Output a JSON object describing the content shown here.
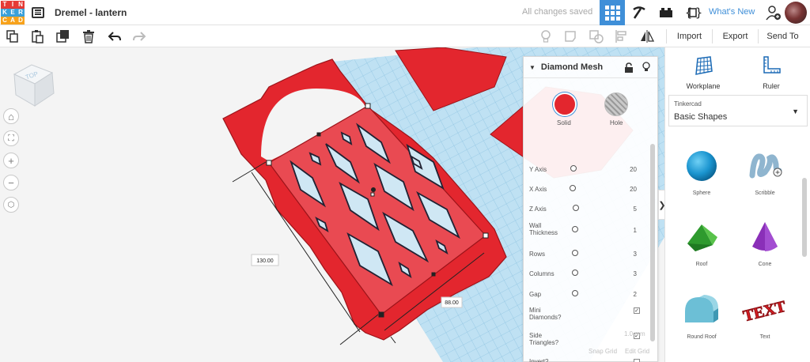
{
  "app": {
    "logo_letters": [
      "T",
      "I",
      "N",
      "K",
      "E",
      "R",
      "C",
      "A",
      "D"
    ],
    "logo_colors": [
      "#e63a35",
      "#e63a35",
      "#e63a35",
      "#3aa0d9",
      "#3aa0d9",
      "#3aa0d9",
      "#f7a21b",
      "#f7a21b",
      "#f7a21b"
    ],
    "doc_title": "Dremel - lantern",
    "save_status": "All changes saved",
    "whats_new": "What's New",
    "accent": "#3f8fd8"
  },
  "toolbar": {
    "import": "Import",
    "export": "Export",
    "send_to": "Send To"
  },
  "view": {
    "cube_label": "TOP",
    "dimension_length": "130.00",
    "dimension_width": "88.00"
  },
  "inspector": {
    "title": "Diamond Mesh",
    "solid_label": "Solid",
    "hole_label": "Hole",
    "solid_color": "#e3262e",
    "properties": [
      {
        "label": "Y Axis",
        "value": "20"
      },
      {
        "label": "X Axis",
        "value": "20"
      },
      {
        "label": "Z Axis",
        "value": "5"
      },
      {
        "label": "Wall Thickness",
        "value": "1"
      },
      {
        "label": "Rows",
        "value": "3"
      },
      {
        "label": "Columns",
        "value": "3"
      },
      {
        "label": "Gap",
        "value": "2"
      }
    ],
    "checkboxes": [
      {
        "label": "Mini Diamonds?",
        "checked": true
      },
      {
        "label": "Side Triangles?",
        "checked": true
      },
      {
        "label": "Invert?",
        "checked": false
      }
    ],
    "ghost_text": {
      "snap_grid": "Snap Grid",
      "edit_grid": "Edit Grid",
      "units": "1.0 mm"
    }
  },
  "library": {
    "workplane_label": "Workplane",
    "ruler_label": "Ruler",
    "provider": "Tinkercad",
    "category": "Basic Shapes",
    "shapes": [
      {
        "name": "Sphere",
        "icon": "sphere-icon"
      },
      {
        "name": "Scribble",
        "icon": "scribble-icon"
      },
      {
        "name": "Roof",
        "icon": "roof-icon"
      },
      {
        "name": "Cone",
        "icon": "cone-icon"
      },
      {
        "name": "Round Roof",
        "icon": "round-roof-icon"
      },
      {
        "name": "Text",
        "icon": "text-icon"
      }
    ],
    "text_shape_word": "TEXT"
  }
}
